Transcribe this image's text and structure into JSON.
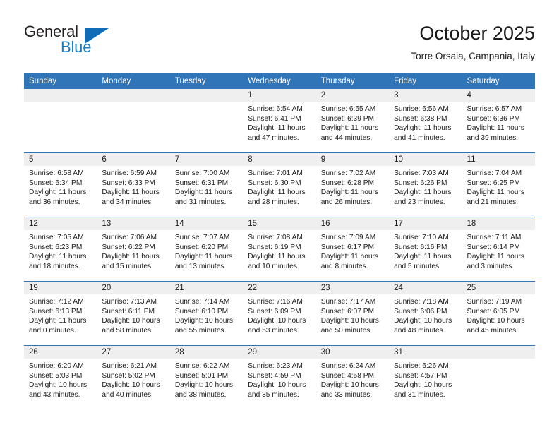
{
  "brand": {
    "name_part1": "General",
    "name_part2": "Blue",
    "logo_icon": "blue-flag-triangle-icon",
    "accent_color": "#1a7fc1",
    "flag_color": "#0f6cb5"
  },
  "header": {
    "month_title": "October 2025",
    "location": "Torre Orsaia, Campania, Italy"
  },
  "calendar": {
    "header_color": "#3075b8",
    "daynum_band_color": "#efefef",
    "row_separator_color": "#2f74b6",
    "weekday_headers": [
      "Sunday",
      "Monday",
      "Tuesday",
      "Wednesday",
      "Thursday",
      "Friday",
      "Saturday"
    ],
    "weeks": [
      [
        {
          "day": "",
          "empty": true,
          "sunrise": "",
          "sunset": "",
          "daylight_line1": "",
          "daylight_line2": ""
        },
        {
          "day": "",
          "empty": true,
          "sunrise": "",
          "sunset": "",
          "daylight_line1": "",
          "daylight_line2": ""
        },
        {
          "day": "",
          "empty": true,
          "sunrise": "",
          "sunset": "",
          "daylight_line1": "",
          "daylight_line2": ""
        },
        {
          "day": "1",
          "empty": false,
          "sunrise": "Sunrise: 6:54 AM",
          "sunset": "Sunset: 6:41 PM",
          "daylight_line1": "Daylight: 11 hours",
          "daylight_line2": "and 47 minutes."
        },
        {
          "day": "2",
          "empty": false,
          "sunrise": "Sunrise: 6:55 AM",
          "sunset": "Sunset: 6:39 PM",
          "daylight_line1": "Daylight: 11 hours",
          "daylight_line2": "and 44 minutes."
        },
        {
          "day": "3",
          "empty": false,
          "sunrise": "Sunrise: 6:56 AM",
          "sunset": "Sunset: 6:38 PM",
          "daylight_line1": "Daylight: 11 hours",
          "daylight_line2": "and 41 minutes."
        },
        {
          "day": "4",
          "empty": false,
          "sunrise": "Sunrise: 6:57 AM",
          "sunset": "Sunset: 6:36 PM",
          "daylight_line1": "Daylight: 11 hours",
          "daylight_line2": "and 39 minutes."
        }
      ],
      [
        {
          "day": "5",
          "empty": false,
          "sunrise": "Sunrise: 6:58 AM",
          "sunset": "Sunset: 6:34 PM",
          "daylight_line1": "Daylight: 11 hours",
          "daylight_line2": "and 36 minutes."
        },
        {
          "day": "6",
          "empty": false,
          "sunrise": "Sunrise: 6:59 AM",
          "sunset": "Sunset: 6:33 PM",
          "daylight_line1": "Daylight: 11 hours",
          "daylight_line2": "and 34 minutes."
        },
        {
          "day": "7",
          "empty": false,
          "sunrise": "Sunrise: 7:00 AM",
          "sunset": "Sunset: 6:31 PM",
          "daylight_line1": "Daylight: 11 hours",
          "daylight_line2": "and 31 minutes."
        },
        {
          "day": "8",
          "empty": false,
          "sunrise": "Sunrise: 7:01 AM",
          "sunset": "Sunset: 6:30 PM",
          "daylight_line1": "Daylight: 11 hours",
          "daylight_line2": "and 28 minutes."
        },
        {
          "day": "9",
          "empty": false,
          "sunrise": "Sunrise: 7:02 AM",
          "sunset": "Sunset: 6:28 PM",
          "daylight_line1": "Daylight: 11 hours",
          "daylight_line2": "and 26 minutes."
        },
        {
          "day": "10",
          "empty": false,
          "sunrise": "Sunrise: 7:03 AM",
          "sunset": "Sunset: 6:26 PM",
          "daylight_line1": "Daylight: 11 hours",
          "daylight_line2": "and 23 minutes."
        },
        {
          "day": "11",
          "empty": false,
          "sunrise": "Sunrise: 7:04 AM",
          "sunset": "Sunset: 6:25 PM",
          "daylight_line1": "Daylight: 11 hours",
          "daylight_line2": "and 21 minutes."
        }
      ],
      [
        {
          "day": "12",
          "empty": false,
          "sunrise": "Sunrise: 7:05 AM",
          "sunset": "Sunset: 6:23 PM",
          "daylight_line1": "Daylight: 11 hours",
          "daylight_line2": "and 18 minutes."
        },
        {
          "day": "13",
          "empty": false,
          "sunrise": "Sunrise: 7:06 AM",
          "sunset": "Sunset: 6:22 PM",
          "daylight_line1": "Daylight: 11 hours",
          "daylight_line2": "and 15 minutes."
        },
        {
          "day": "14",
          "empty": false,
          "sunrise": "Sunrise: 7:07 AM",
          "sunset": "Sunset: 6:20 PM",
          "daylight_line1": "Daylight: 11 hours",
          "daylight_line2": "and 13 minutes."
        },
        {
          "day": "15",
          "empty": false,
          "sunrise": "Sunrise: 7:08 AM",
          "sunset": "Sunset: 6:19 PM",
          "daylight_line1": "Daylight: 11 hours",
          "daylight_line2": "and 10 minutes."
        },
        {
          "day": "16",
          "empty": false,
          "sunrise": "Sunrise: 7:09 AM",
          "sunset": "Sunset: 6:17 PM",
          "daylight_line1": "Daylight: 11 hours",
          "daylight_line2": "and 8 minutes."
        },
        {
          "day": "17",
          "empty": false,
          "sunrise": "Sunrise: 7:10 AM",
          "sunset": "Sunset: 6:16 PM",
          "daylight_line1": "Daylight: 11 hours",
          "daylight_line2": "and 5 minutes."
        },
        {
          "day": "18",
          "empty": false,
          "sunrise": "Sunrise: 7:11 AM",
          "sunset": "Sunset: 6:14 PM",
          "daylight_line1": "Daylight: 11 hours",
          "daylight_line2": "and 3 minutes."
        }
      ],
      [
        {
          "day": "19",
          "empty": false,
          "sunrise": "Sunrise: 7:12 AM",
          "sunset": "Sunset: 6:13 PM",
          "daylight_line1": "Daylight: 11 hours",
          "daylight_line2": "and 0 minutes."
        },
        {
          "day": "20",
          "empty": false,
          "sunrise": "Sunrise: 7:13 AM",
          "sunset": "Sunset: 6:11 PM",
          "daylight_line1": "Daylight: 10 hours",
          "daylight_line2": "and 58 minutes."
        },
        {
          "day": "21",
          "empty": false,
          "sunrise": "Sunrise: 7:14 AM",
          "sunset": "Sunset: 6:10 PM",
          "daylight_line1": "Daylight: 10 hours",
          "daylight_line2": "and 55 minutes."
        },
        {
          "day": "22",
          "empty": false,
          "sunrise": "Sunrise: 7:16 AM",
          "sunset": "Sunset: 6:09 PM",
          "daylight_line1": "Daylight: 10 hours",
          "daylight_line2": "and 53 minutes."
        },
        {
          "day": "23",
          "empty": false,
          "sunrise": "Sunrise: 7:17 AM",
          "sunset": "Sunset: 6:07 PM",
          "daylight_line1": "Daylight: 10 hours",
          "daylight_line2": "and 50 minutes."
        },
        {
          "day": "24",
          "empty": false,
          "sunrise": "Sunrise: 7:18 AM",
          "sunset": "Sunset: 6:06 PM",
          "daylight_line1": "Daylight: 10 hours",
          "daylight_line2": "and 48 minutes."
        },
        {
          "day": "25",
          "empty": false,
          "sunrise": "Sunrise: 7:19 AM",
          "sunset": "Sunset: 6:05 PM",
          "daylight_line1": "Daylight: 10 hours",
          "daylight_line2": "and 45 minutes."
        }
      ],
      [
        {
          "day": "26",
          "empty": false,
          "sunrise": "Sunrise: 6:20 AM",
          "sunset": "Sunset: 5:03 PM",
          "daylight_line1": "Daylight: 10 hours",
          "daylight_line2": "and 43 minutes."
        },
        {
          "day": "27",
          "empty": false,
          "sunrise": "Sunrise: 6:21 AM",
          "sunset": "Sunset: 5:02 PM",
          "daylight_line1": "Daylight: 10 hours",
          "daylight_line2": "and 40 minutes."
        },
        {
          "day": "28",
          "empty": false,
          "sunrise": "Sunrise: 6:22 AM",
          "sunset": "Sunset: 5:01 PM",
          "daylight_line1": "Daylight: 10 hours",
          "daylight_line2": "and 38 minutes."
        },
        {
          "day": "29",
          "empty": false,
          "sunrise": "Sunrise: 6:23 AM",
          "sunset": "Sunset: 4:59 PM",
          "daylight_line1": "Daylight: 10 hours",
          "daylight_line2": "and 35 minutes."
        },
        {
          "day": "30",
          "empty": false,
          "sunrise": "Sunrise: 6:24 AM",
          "sunset": "Sunset: 4:58 PM",
          "daylight_line1": "Daylight: 10 hours",
          "daylight_line2": "and 33 minutes."
        },
        {
          "day": "31",
          "empty": false,
          "sunrise": "Sunrise: 6:26 AM",
          "sunset": "Sunset: 4:57 PM",
          "daylight_line1": "Daylight: 10 hours",
          "daylight_line2": "and 31 minutes."
        },
        {
          "day": "",
          "empty": true,
          "sunrise": "",
          "sunset": "",
          "daylight_line1": "",
          "daylight_line2": ""
        }
      ]
    ]
  }
}
